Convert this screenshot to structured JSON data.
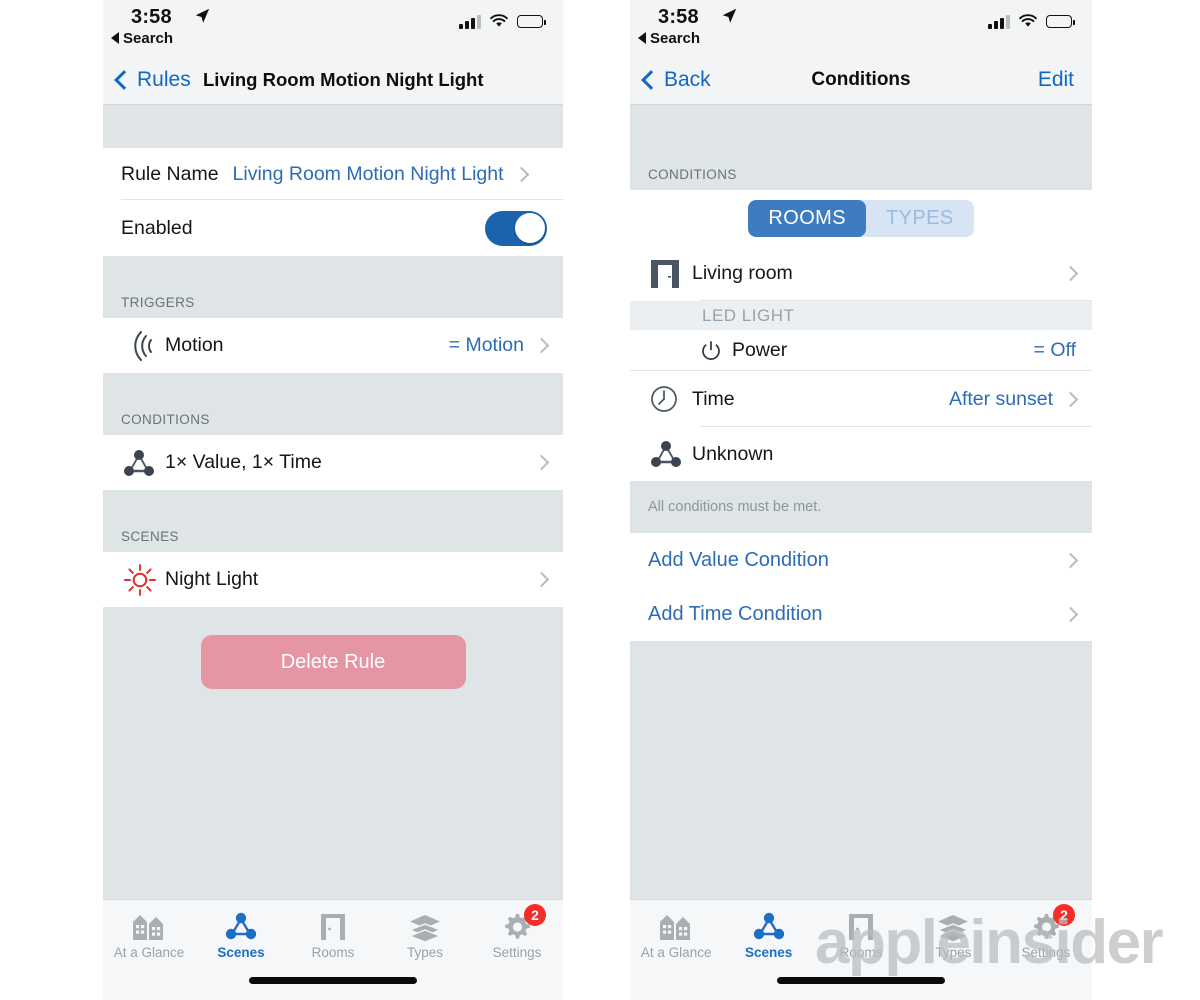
{
  "statusbar": {
    "time": "3:58",
    "back_label": "Search",
    "location_icon": "location-arrow-icon",
    "signal_icon": "cellular-signal-icon",
    "wifi_icon": "wifi-icon",
    "battery_icon": "battery-icon"
  },
  "left": {
    "nav": {
      "back_label": "Rules",
      "title": "Living Room Motion Night Light"
    },
    "rule_name": {
      "label": "Rule Name",
      "value": "Living Room Motion Night Light"
    },
    "enabled": {
      "label": "Enabled",
      "state": "on"
    },
    "triggers": {
      "header": "TRIGGERS",
      "rows": [
        {
          "icon": "motion-waves-icon",
          "label": "Motion",
          "value": "= Motion"
        }
      ]
    },
    "conditions": {
      "header": "CONDITIONS",
      "rows": [
        {
          "icon": "scene-nodes-icon",
          "label": "1× Value, 1× Time"
        }
      ]
    },
    "scenes": {
      "header": "SCENES",
      "rows": [
        {
          "icon": "sun-icon",
          "label": "Night Light"
        }
      ]
    },
    "delete_button": "Delete Rule"
  },
  "right": {
    "nav": {
      "back_label": "Back",
      "title": "Conditions",
      "edit_label": "Edit"
    },
    "section_header": "CONDITIONS",
    "segmented": {
      "options": [
        "ROOMS",
        "TYPES"
      ],
      "selected": "ROOMS"
    },
    "room_row": {
      "icon": "door-icon",
      "label": "Living room"
    },
    "device_header": "LED LIGHT",
    "power_row": {
      "icon": "power-icon",
      "label": "Power",
      "value": "= Off"
    },
    "time_row": {
      "icon": "clock-icon",
      "label": "Time",
      "value": "After sunset"
    },
    "unknown_row": {
      "icon": "scene-nodes-icon",
      "label": "Unknown"
    },
    "footnote": "All conditions must be met.",
    "add_value_condition": "Add Value Condition",
    "add_time_condition": "Add Time Condition"
  },
  "tabbar": {
    "tabs": [
      {
        "label": "At a Glance",
        "icon": "buildings-icon",
        "active": false
      },
      {
        "label": "Scenes",
        "icon": "scene-nodes-icon",
        "active": true
      },
      {
        "label": "Rooms",
        "icon": "door-icon",
        "active": false
      },
      {
        "label": "Types",
        "icon": "layers-icon",
        "active": false
      },
      {
        "label": "Settings",
        "icon": "gear-icon",
        "active": false,
        "badge": "2"
      }
    ]
  },
  "watermark": "appleinsider",
  "colors": {
    "accent_blue": "#1168c4",
    "value_blue": "#2d6cb5",
    "toggle_blue": "#1b63ad",
    "segment_blue": "#3d7cc0",
    "delete_pink": "#e695a3",
    "badge_red": "#f52c28",
    "sun_red": "#e02b2b",
    "icon_slate": "#4a5563",
    "group_bg": "#dfe5e6"
  }
}
